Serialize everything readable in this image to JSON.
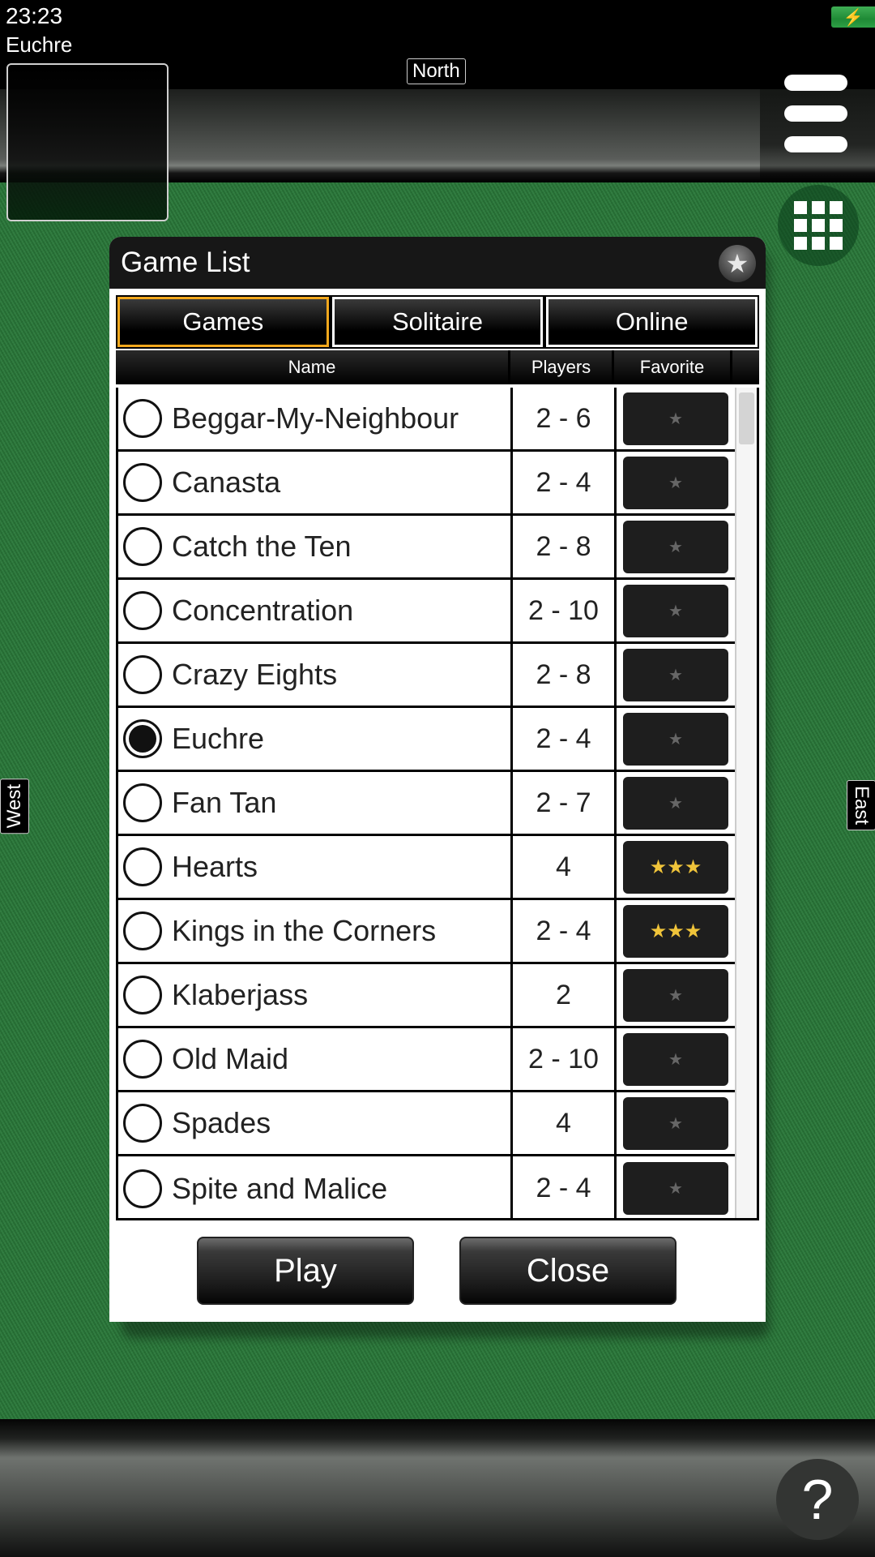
{
  "status_bar": {
    "time": "23:23",
    "battery_icon": "charging-battery-icon"
  },
  "header": {
    "game_name": "Euchre"
  },
  "seats": {
    "north": "North",
    "west": "West",
    "east": "East"
  },
  "icons": {
    "menu": "hamburger-menu-icon",
    "grid": "grid-icon",
    "help": "?",
    "star": "★",
    "charging": "⚡"
  },
  "dialog": {
    "title": "Game List",
    "tabs": [
      {
        "label": "Games",
        "active": true
      },
      {
        "label": "Solitaire",
        "active": false
      },
      {
        "label": "Online",
        "active": false
      }
    ],
    "columns": {
      "name": "Name",
      "players": "Players",
      "favorite": "Favorite"
    },
    "rows": [
      {
        "name": "Beggar-My-Neighbour",
        "players": "2 - 6",
        "selected": false,
        "favorite_stars": "★",
        "favorite": false
      },
      {
        "name": "Canasta",
        "players": "2 - 4",
        "selected": false,
        "favorite_stars": "★",
        "favorite": false
      },
      {
        "name": "Catch the Ten",
        "players": "2 - 8",
        "selected": false,
        "favorite_stars": "★",
        "favorite": false
      },
      {
        "name": "Concentration",
        "players": "2 - 10",
        "selected": false,
        "favorite_stars": "★",
        "favorite": false
      },
      {
        "name": "Crazy Eights",
        "players": "2 - 8",
        "selected": false,
        "favorite_stars": "★",
        "favorite": false
      },
      {
        "name": "Euchre",
        "players": "2 - 4",
        "selected": true,
        "favorite_stars": "★",
        "favorite": false
      },
      {
        "name": "Fan Tan",
        "players": "2 - 7",
        "selected": false,
        "favorite_stars": "★",
        "favorite": false
      },
      {
        "name": "Hearts",
        "players": "4",
        "selected": false,
        "favorite_stars": "★★★",
        "favorite": true
      },
      {
        "name": "Kings in the Corners",
        "players": "2 - 4",
        "selected": false,
        "favorite_stars": "★★★",
        "favorite": true
      },
      {
        "name": "Klaberjass",
        "players": "2",
        "selected": false,
        "favorite_stars": "★",
        "favorite": false
      },
      {
        "name": "Old Maid",
        "players": "2 - 10",
        "selected": false,
        "favorite_stars": "★",
        "favorite": false
      },
      {
        "name": "Spades",
        "players": "4",
        "selected": false,
        "favorite_stars": "★",
        "favorite": false
      },
      {
        "name": "Spite and Malice",
        "players": "2 - 4",
        "selected": false,
        "favorite_stars": "★",
        "favorite": false
      }
    ],
    "buttons": {
      "play": "Play",
      "close": "Close"
    }
  },
  "colors": {
    "felt": "#2a7a3a",
    "active_tab_border": "#f2a81d",
    "favorite_star": "#f0c43a",
    "battery": "#2da045"
  }
}
